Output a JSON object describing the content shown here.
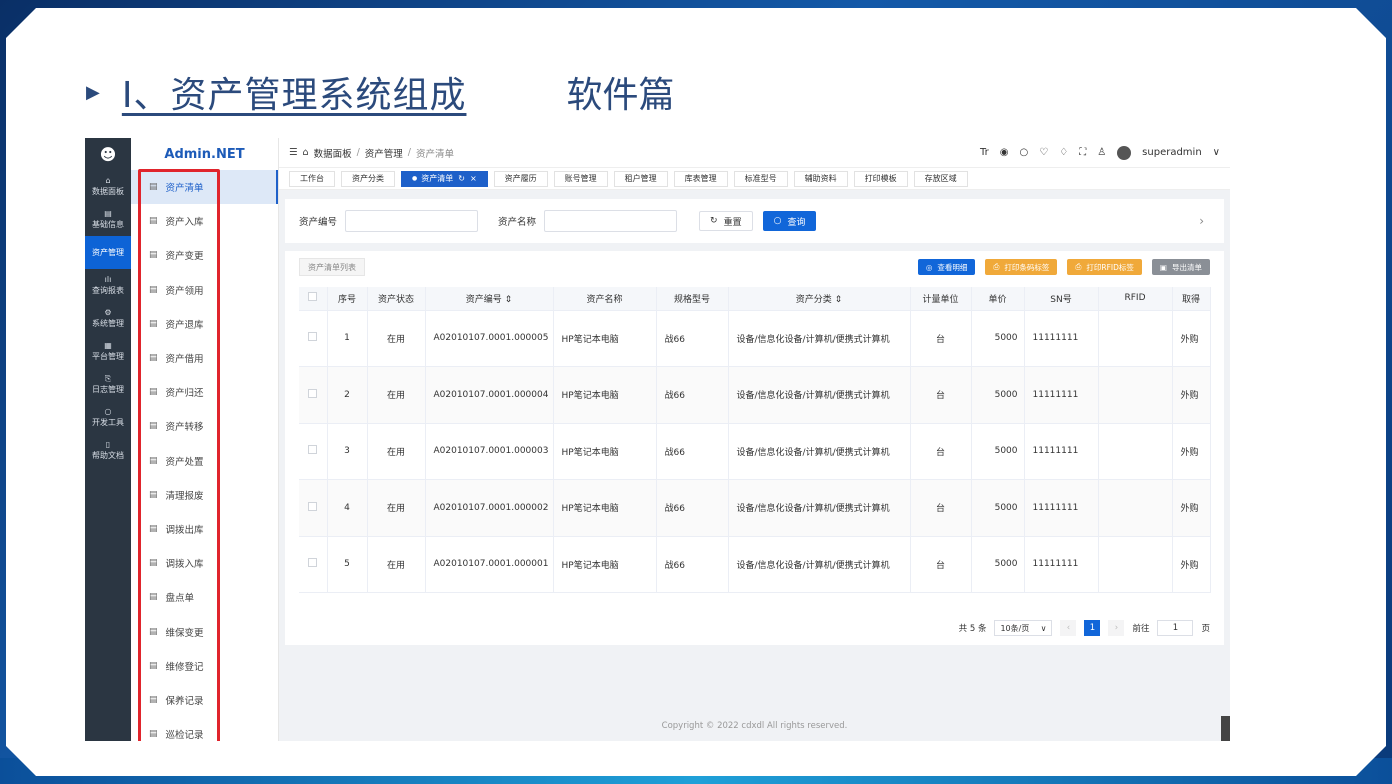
{
  "slide": {
    "marker": "▶",
    "title": "Ⅰ、资产管理系统组成",
    "subtitle": "软件篇"
  },
  "rail": {
    "items": [
      {
        "icon": "home-icon",
        "glyph": "⌂",
        "label": "数据面板"
      },
      {
        "icon": "doc-icon",
        "glyph": "▤",
        "label": "基础信息"
      },
      {
        "icon": "asset-icon",
        "glyph": "",
        "label": "资产管理",
        "active": true
      },
      {
        "icon": "chart-icon",
        "glyph": "ılı",
        "label": "查询报表"
      },
      {
        "icon": "gear-icon",
        "glyph": "⚙",
        "label": "系统管理"
      },
      {
        "icon": "grid-icon",
        "glyph": "▦",
        "label": "平台管理"
      },
      {
        "icon": "log-icon",
        "glyph": "⎘",
        "label": "日志管理"
      },
      {
        "icon": "dev-icon",
        "glyph": "○",
        "label": "开发工具"
      },
      {
        "icon": "help-icon",
        "glyph": "▯",
        "label": "帮助文档"
      }
    ]
  },
  "menu": {
    "brand": "Admin.NET",
    "items": [
      "资产清单",
      "资产入库",
      "资产变更",
      "资产领用",
      "资产退库",
      "资产借用",
      "资产归还",
      "资产转移",
      "资产处置",
      "清理报废",
      "调拨出库",
      "调拨入库",
      "盘点单",
      "维保变更",
      "维修登记",
      "保养记录",
      "巡检记录"
    ],
    "active_index": 0
  },
  "breadcrumb": {
    "items": [
      "数据面板",
      "资产管理",
      "资产清单"
    ]
  },
  "user": {
    "name": "superadmin"
  },
  "tabs": [
    "工作台",
    "资产分类",
    "资产清单",
    "资产履历",
    "账号管理",
    "租户管理",
    "库表管理",
    "标准型号",
    "辅助资料",
    "打印模板",
    "存放区域"
  ],
  "active_tab": 2,
  "search": {
    "asset_no_label": "资产编号",
    "asset_name_label": "资产名称",
    "reset": "重置",
    "query": "查询"
  },
  "table_card": {
    "list_tab": "资产清单列表",
    "actions": [
      "查看明细",
      "打印条码标签",
      "打印RFID标签",
      "导出清单"
    ],
    "columns": [
      "",
      "序号",
      "资产状态",
      "资产编号 ⇕",
      "资产名称",
      "规格型号",
      "资产分类 ⇕",
      "计量单位",
      "单价",
      "SN号",
      "RFID",
      "取得"
    ],
    "rows": [
      [
        "1",
        "在用",
        "A02010107.0001.000005",
        "HP笔记本电脑",
        "战66",
        "设备/信息化设备/计算机/便携式计算机",
        "台",
        "5000",
        "11111111",
        "",
        "外购"
      ],
      [
        "2",
        "在用",
        "A02010107.0001.000004",
        "HP笔记本电脑",
        "战66",
        "设备/信息化设备/计算机/便携式计算机",
        "台",
        "5000",
        "11111111",
        "",
        "外购"
      ],
      [
        "3",
        "在用",
        "A02010107.0001.000003",
        "HP笔记本电脑",
        "战66",
        "设备/信息化设备/计算机/便携式计算机",
        "台",
        "5000",
        "11111111",
        "",
        "外购"
      ],
      [
        "4",
        "在用",
        "A02010107.0001.000002",
        "HP笔记本电脑",
        "战66",
        "设备/信息化设备/计算机/便携式计算机",
        "台",
        "5000",
        "11111111",
        "",
        "外购"
      ],
      [
        "5",
        "在用",
        "A02010107.0001.000001",
        "HP笔记本电脑",
        "战66",
        "设备/信息化设备/计算机/便携式计算机",
        "台",
        "5000",
        "11111111",
        "",
        "外购"
      ]
    ]
  },
  "pager": {
    "total": "共 5 条",
    "page_size": "10条/页",
    "current": "1",
    "goto_label": "前往",
    "goto_value": "1",
    "page_unit": "页"
  },
  "copyright": "Copyright © 2022 cdxdl All rights reserved."
}
